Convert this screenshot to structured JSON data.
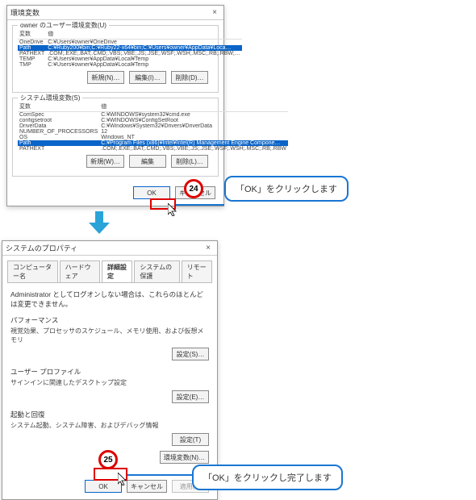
{
  "env": {
    "title": "環境変数",
    "close": "×",
    "userGroup": "owner のユーザー環境変数(U)",
    "sysGroup": "システム環境変数(S)",
    "hdrVar": "変数",
    "hdrVal": "値",
    "btnNew": "新規(N)…",
    "btnEdit": "編集(I)…",
    "btnDel": "削除(D)…",
    "btnNew2": "新規(W)…",
    "btnEdit2": "編集",
    "btnDel2": "削除(L)…",
    "ok": "OK",
    "cancel": "キャンセル",
    "userVars": [
      {
        "k": "OneDrive",
        "v": "C:¥Users¥owner¥OneDrive"
      },
      {
        "k": "Path",
        "v": "C:¥Ruby200¥bin;C:¥Ruby22-x64¥bin;C:¥Users¥owner¥AppData¥Loca…"
      },
      {
        "k": "PATHEXT",
        "v": ".COM;.EXE;.BAT;.CMD;.VBS;.VBE;.JS;.JSE;.WSF;.WSH;.MSC;.RB;.RBW;…"
      },
      {
        "k": "TEMP",
        "v": "C:¥Users¥owner¥AppData¥Local¥Temp"
      },
      {
        "k": "TMP",
        "v": "C:¥Users¥owner¥AppData¥Local¥Temp"
      }
    ],
    "sysVars": [
      {
        "k": "ComSpec",
        "v": "C:¥WINDOWS¥system32¥cmd.exe"
      },
      {
        "k": "configsetroot",
        "v": "C:¥WINDOWS¥ConfigSetRoot"
      },
      {
        "k": "DriverData",
        "v": "C:¥Windows¥System32¥Drivers¥DriverData"
      },
      {
        "k": "NUMBER_OF_PROCESSORS",
        "v": "12"
      },
      {
        "k": "OS",
        "v": "Windows_NT"
      },
      {
        "k": "Path",
        "v": "C:¥Program Files (x86)¥Intel¥Intel(R) Management Engine Compone…"
      },
      {
        "k": "PATHEXT",
        "v": ".COM;.EXE;.BAT;.CMD;.VBS;.VBE;.JS;.JSE;.WSF;.WSH;.MSC;.RB;.RBW"
      }
    ]
  },
  "sys": {
    "title": "システムのプロパティ",
    "close": "×",
    "tabs": [
      "コンピューター名",
      "ハードウェア",
      "詳細設定",
      "システムの保護",
      "リモート"
    ],
    "activeTab": 2,
    "adminNote": "Administrator としてログオンしない場合は、これらのほとんどは変更できません。",
    "perfTitle": "パフォーマンス",
    "perfDesc": "視覚効果、プロセッサのスケジュール、メモリ使用、および仮想メモリ",
    "perfBtn": "設定(S)…",
    "profTitle": "ユーザー プロファイル",
    "profDesc": "サインインに関連したデスクトップ設定",
    "profBtn": "設定(E)…",
    "bootTitle": "起動と回復",
    "bootDesc": "システム起動、システム障害、およびデバッグ情報",
    "bootBtn": "設定(T)",
    "envBtn": "環境変数(N)…",
    "ok": "OK",
    "cancel": "キャンセル",
    "apply": "適用(A)"
  },
  "annot": {
    "n24": "24",
    "n25": "25",
    "c24": "「OK」をクリックします",
    "c25": "「OK」をクリックし完了します"
  }
}
